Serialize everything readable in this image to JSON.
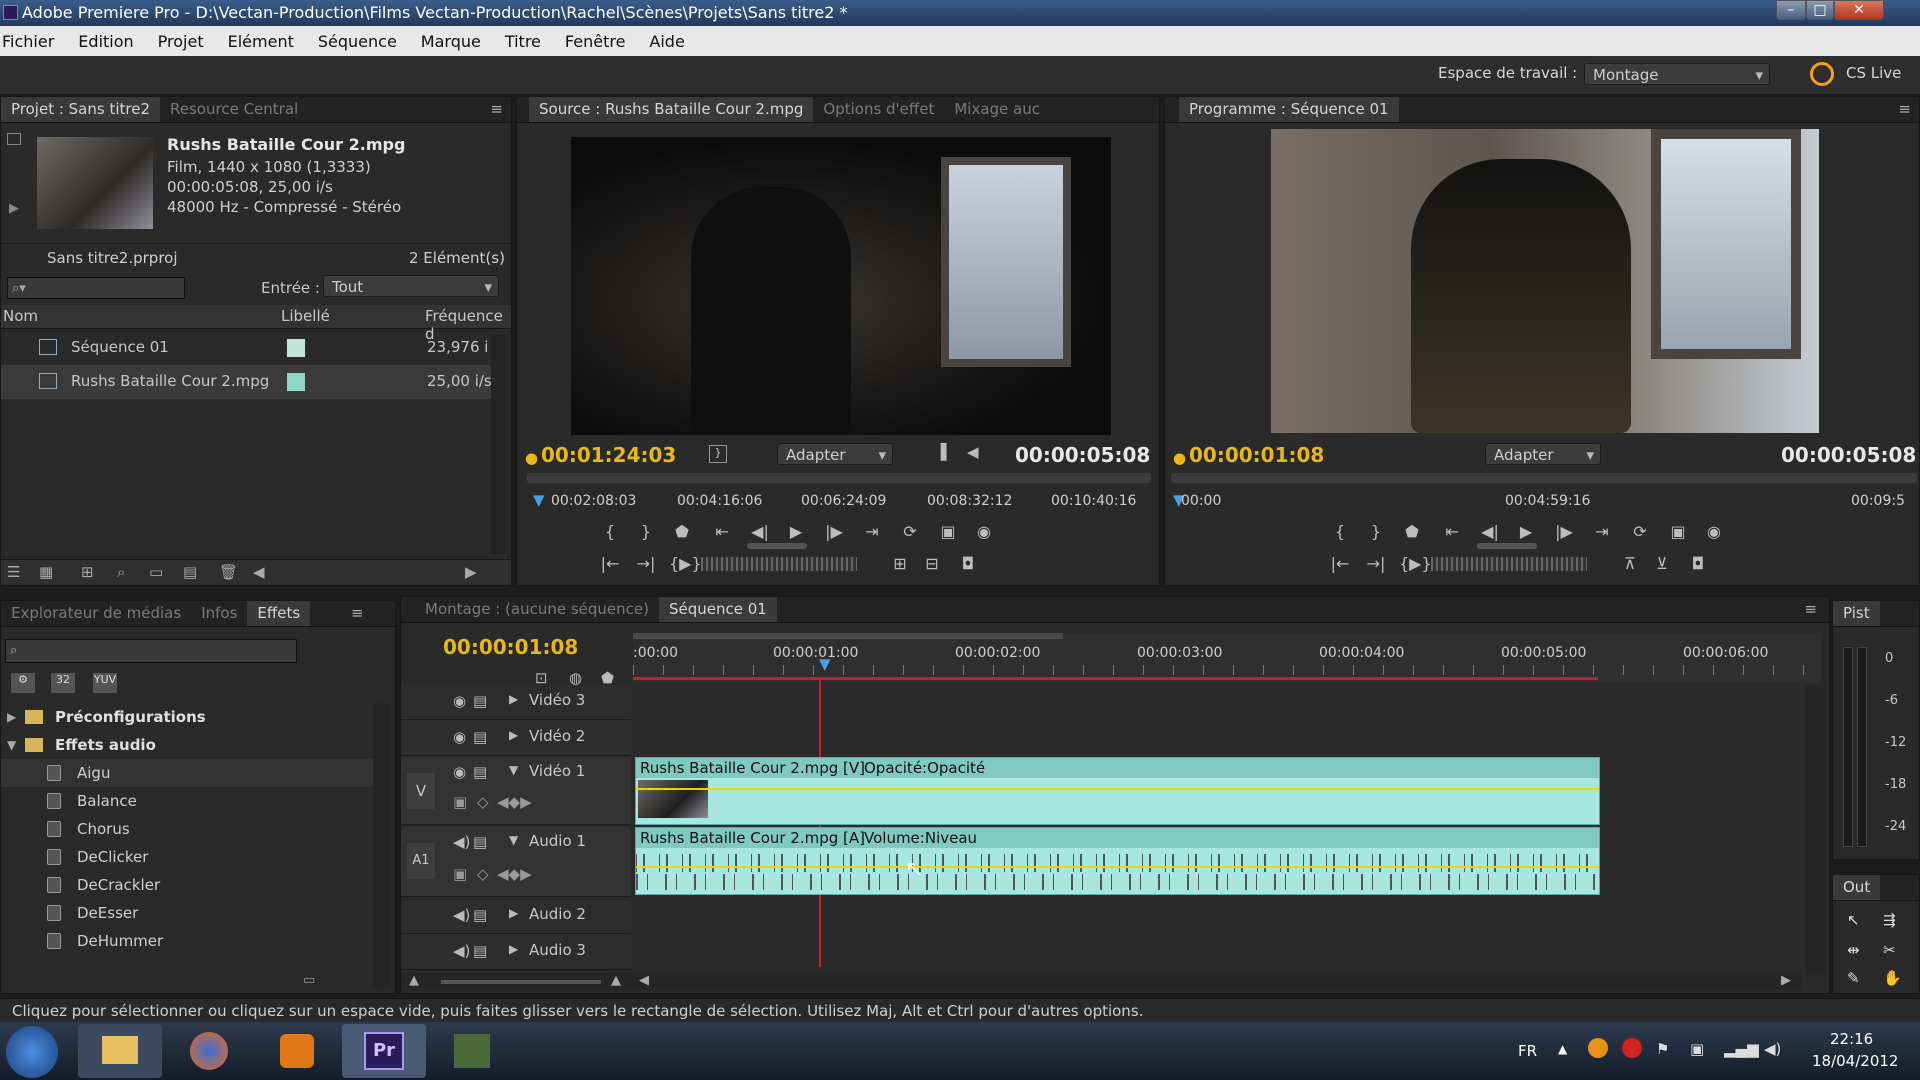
{
  "window": {
    "title": "Adobe Premiere Pro - D:\\Vectan-Production\\Films Vectan-Production\\Rachel\\Scènes\\Projets\\Sans titre2 *"
  },
  "menu": [
    "Fichier",
    "Edition",
    "Projet",
    "Elément",
    "Séquence",
    "Marque",
    "Titre",
    "Fenêtre",
    "Aide"
  ],
  "workspace": {
    "label": "Espace de travail :",
    "value": "Montage",
    "cs_live": "CS Live"
  },
  "project": {
    "tabs": [
      "Projet : Sans titre2",
      "Resource Central"
    ],
    "clip_name": "Rushs Bataille Cour 2.mpg",
    "clip_info": [
      "Film, 1440 x 1080 (1,3333)",
      "00:00:05:08, 25,00 i/s",
      "48000 Hz - Compressé - Stéréo"
    ],
    "file": "Sans titre2.prproj",
    "count": "2 Elément(s)",
    "entry_label": "Entrée :",
    "entry_value": "Tout",
    "columns": [
      "Nom",
      "Libellé",
      "Fréquence d"
    ],
    "items": [
      {
        "name": "Séquence 01",
        "rate": "23,976 i",
        "color": "#bfe3d6"
      },
      {
        "name": "Rushs Bataille Cour 2.mpg",
        "rate": "25,00 i/s",
        "color": "#8fd6c4"
      }
    ]
  },
  "source": {
    "tabs": [
      "Source : Rushs Bataille Cour 2.mpg",
      "Options d'effet",
      "Mixage auc"
    ],
    "timecode": "00:01:24:03",
    "fit": "Adapter",
    "duration": "00:00:05:08",
    "ruler": [
      "00:02:08:03",
      "00:04:16:06",
      "00:06:24:09",
      "00:08:32:12",
      "00:10:40:16"
    ]
  },
  "program": {
    "tab": "Programme : Séquence 01",
    "timecode": "00:00:01:08",
    "fit": "Adapter",
    "duration": "00:00:05:08",
    "ruler": [
      "00:00",
      "00:04:59:16",
      "00:09:5"
    ]
  },
  "effects": {
    "tabs": [
      "Explorateur de médias",
      "Infos",
      "Effets"
    ],
    "folders": [
      "Préconfigurations",
      "Effets audio"
    ],
    "items": [
      "Aigu",
      "Balance",
      "Chorus",
      "DeClicker",
      "DeCrackler",
      "DeEsser",
      "DeHummer"
    ]
  },
  "timeline": {
    "tabs": [
      "Montage : (aucune séquence)",
      "Séquence 01"
    ],
    "timecode": "00:00:01:08",
    "ruler": [
      ":00:00",
      "00:00:01:00",
      "00:00:02:00",
      "00:00:03:00",
      "00:00:04:00",
      "00:00:05:00",
      "00:00:06:00"
    ],
    "tracks": {
      "v3": "Vidéo 3",
      "v2": "Vidéo 2",
      "v1": "Vidéo 1",
      "a1": "Audio 1",
      "a2": "Audio 2",
      "a3": "Audio 3",
      "v_tag": "V",
      "a_tag": "A1"
    },
    "video_clip": "Rushs Bataille Cour 2.mpg [V]",
    "video_fx": "Opacité:Opacité",
    "audio_clip": "Rushs Bataille Cour 2.mpg [A]",
    "audio_fx": "Volume:Niveau"
  },
  "meter": {
    "tab": "Pist",
    "scale": [
      "0",
      "-6",
      "-12",
      "-18",
      "-24"
    ]
  },
  "tools": {
    "tab": "Out"
  },
  "status": "Cliquez pour sélectionner ou cliquez sur un espace vide, puis faites glisser vers le rectangle de sélection. Utilisez Maj, Alt et Ctrl pour d'autres options.",
  "taskbar": {
    "lang": "FR",
    "time": "22:16",
    "date": "18/04/2012",
    "pr": "Pr"
  }
}
